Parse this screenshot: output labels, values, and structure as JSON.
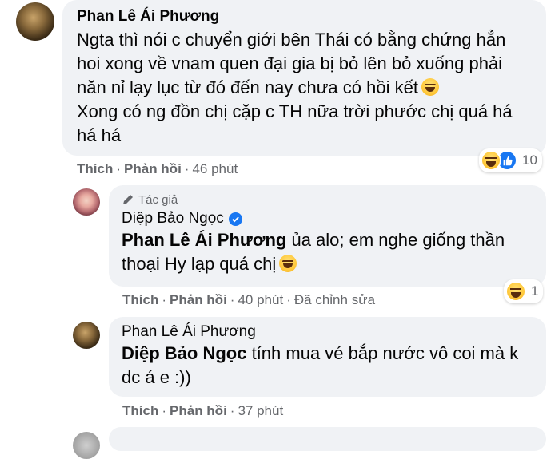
{
  "comments": [
    {
      "author": "Phan Lê Ái Phương",
      "text": "Ngta thì nói c chuyển giới bên Thái có bằng chứng hẳn\nhoi xong về vnam quen đại gia bị bỏ lên bỏ xuống phải\nnăn nỉ lạy lục từ đó đến nay chưa có hồi kết",
      "text_2": "Xong có ng đồn chị cặp c TH nữa trời phước chị quá há\nhá há",
      "actions": {
        "like": "Thích",
        "reply": "Phản hồi",
        "time": "46 phút"
      },
      "reactions": {
        "icons": [
          "haha-icon",
          "like-icon"
        ],
        "count": "10"
      }
    },
    {
      "author_tag": "Tác giả",
      "author": "Diệp Bảo Ngọc",
      "mention": "Phan Lê Ái Phương",
      "text": " ủa alo; em nghe giống thần\nthoại Hy lạp quá chị",
      "actions": {
        "like": "Thích",
        "reply": "Phản hồi",
        "time": "40 phút",
        "edited": "Đã chỉnh sửa"
      },
      "reactions": {
        "icons": [
          "haha-icon"
        ],
        "count": "1"
      }
    },
    {
      "author": "Phan Lê Ái Phương",
      "mention": "Diệp Bảo Ngọc",
      "text": " tính mua vé bắp nước vô coi mà k\ndc á e :))",
      "actions": {
        "like": "Thích",
        "reply": "Phản hồi",
        "time": "37 phút"
      }
    }
  ],
  "colors": {
    "bubble": "#f0f2f5",
    "meta": "#65676b",
    "accent": "#1877f2"
  }
}
